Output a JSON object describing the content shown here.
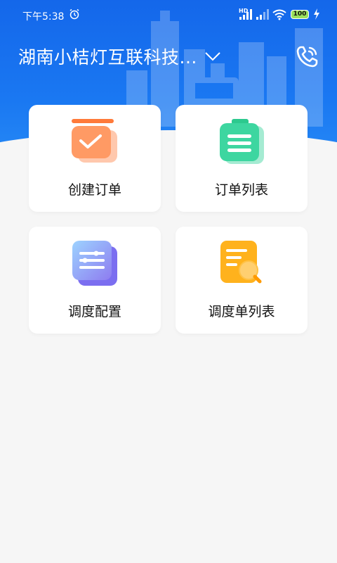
{
  "status_bar": {
    "time": "下午5:38",
    "battery": "100",
    "network_label": "HD",
    "icons": [
      "alarm-icon",
      "signal-icon",
      "signal-icon",
      "wifi-icon",
      "battery-icon",
      "charging-icon"
    ]
  },
  "header": {
    "company_name": "湖南小桔灯互联科技...",
    "dropdown_icon": "chevron-down-icon",
    "phone_icon": "phone-call-icon"
  },
  "menu": [
    {
      "label": "创建订单",
      "icon": "create-order-icon"
    },
    {
      "label": "订单列表",
      "icon": "order-list-icon"
    },
    {
      "label": "调度配置",
      "icon": "dispatch-config-icon"
    },
    {
      "label": "调度单列表",
      "icon": "dispatch-list-icon"
    }
  ],
  "colors": {
    "header_blue": "#1467ea",
    "background": "#f6f6f6",
    "card": "#ffffff",
    "orange": "#ff8a4a",
    "green": "#3dd6a0",
    "purple": "#7b7cf0",
    "yellow": "#ffb21d"
  }
}
